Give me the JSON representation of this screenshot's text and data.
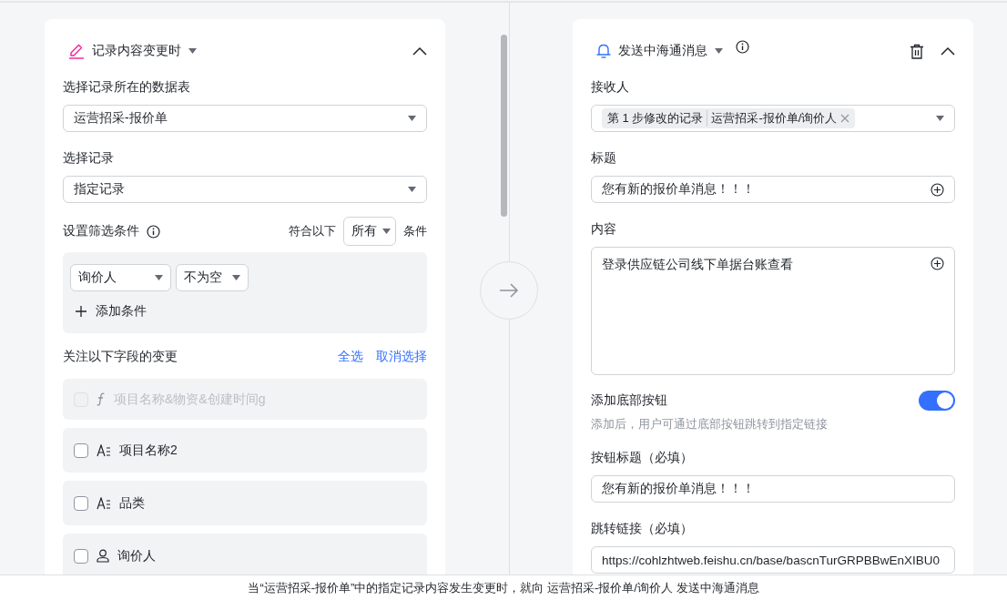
{
  "trigger": {
    "title": "记录内容变更时",
    "table_label": "选择记录所在的数据表",
    "table_value": "运营招采-报价单",
    "record_label": "选择记录",
    "record_value": "指定记录",
    "filter": {
      "label": "设置筛选条件",
      "match_prefix": "符合以下",
      "match_value": "所有",
      "match_suffix": "条件",
      "conditions": [
        {
          "field": "询价人",
          "operator": "不为空"
        }
      ],
      "add_label": "添加条件"
    },
    "watch": {
      "label": "关注以下字段的变更",
      "select_all": "全选",
      "deselect": "取消选择",
      "fields": [
        {
          "name": "项目名称&物资&创建时间g",
          "kind": "formula",
          "checked": false,
          "disabled": true
        },
        {
          "name": "项目名称2",
          "kind": "text",
          "checked": false,
          "disabled": false
        },
        {
          "name": "品类",
          "kind": "text",
          "checked": false,
          "disabled": false
        },
        {
          "name": "询价人",
          "kind": "person",
          "checked": false,
          "disabled": false
        }
      ]
    }
  },
  "action": {
    "title": "发送中海通消息",
    "recipient_label": "接收人",
    "recipient_tag": {
      "step": "第 1 步修改的记录",
      "path": "运营招采-报价单/询价人"
    },
    "title_label": "标题",
    "title_value": "您有新的报价单消息！！！",
    "content_label": "内容",
    "content_value": "登录供应链公司线下单据台账查看",
    "button_toggle": {
      "label": "添加底部按钮",
      "hint": "添加后，用户可通过底部按钮跳转到指定链接",
      "on": true
    },
    "button_title_label": "按钮标题（必填）",
    "button_title_value": "您有新的报价单消息！！！",
    "link_label": "跳转链接（必填）",
    "link_value": "https://cohlzhtweb.feishu.cn/base/bascnTurGRPBBwEnXIBU0"
  },
  "summary": "当“运营招采-报价单”中的指定记录内容发生变更时，就向 运营招采-报价单/询价人 发送中海通消息"
}
